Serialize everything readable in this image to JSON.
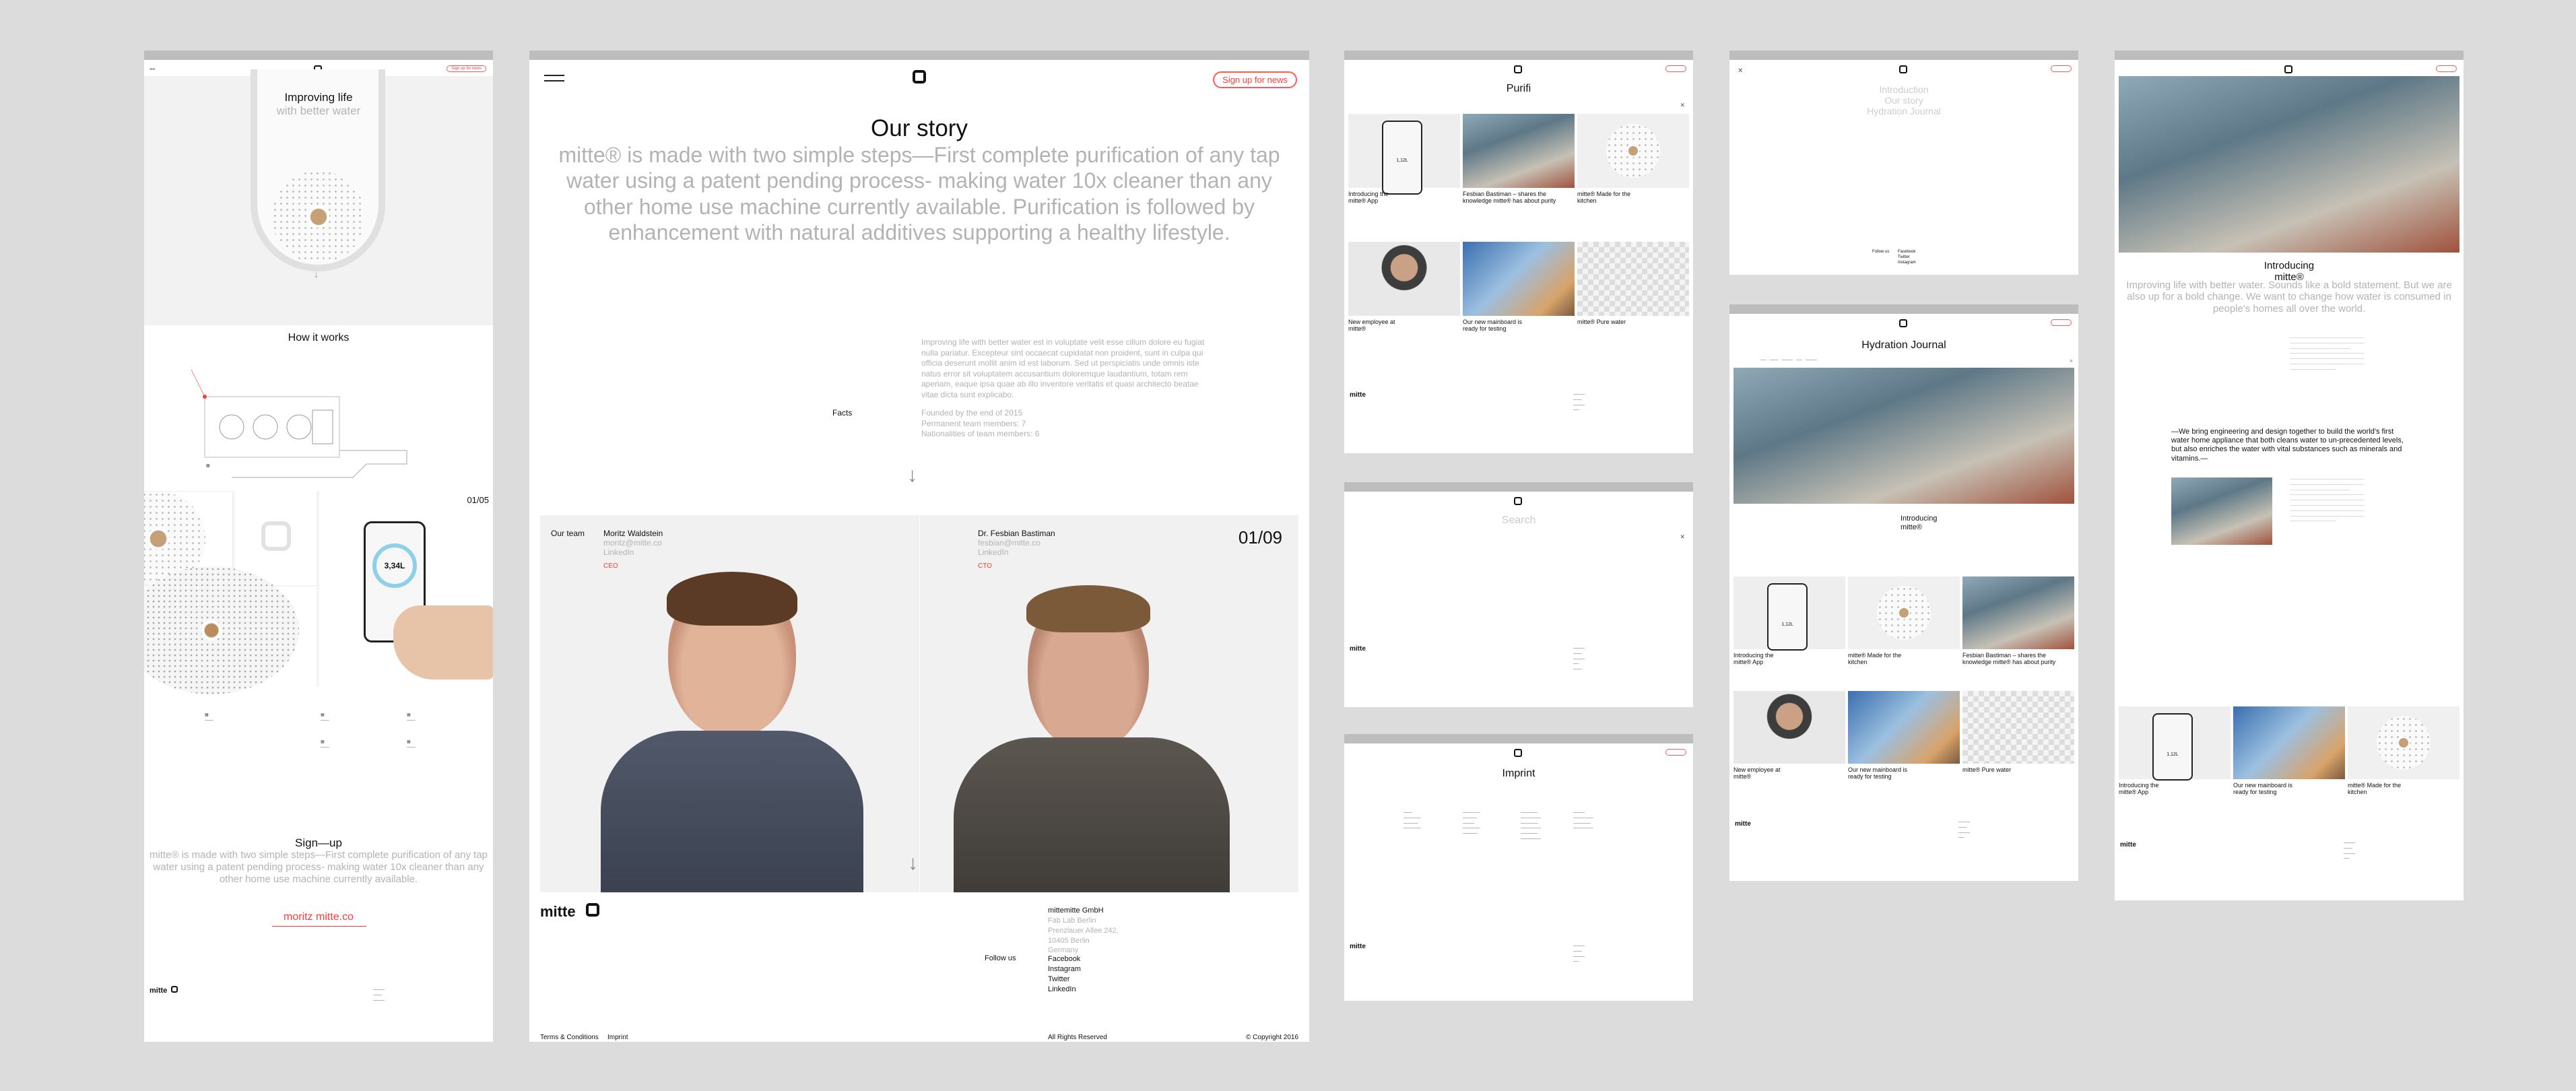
{
  "screen1": {
    "logo_text": "mitte",
    "cta": "Sign up for news",
    "hero_title": "Improving life",
    "hero_subtitle": "with better water",
    "how_title": "How it works",
    "counter": "01/05",
    "phone_value": "3,34L",
    "signup_title": "Sign—up",
    "signup_text": "mitte® is made with two simple steps—First complete purification of any tap water using a patent pending process- making water 10x cleaner than any other home use machine currently available.",
    "signup_email": "moritz mitte.co",
    "footer_brand": "mitte"
  },
  "screen2": {
    "cta": "Sign up for news",
    "title": "Our story",
    "lead": "mitte® is made with two simple steps—First complete purification of any tap water using a patent pending process- making water 10x cleaner than any other home use machine currently available. Purification is followed by enhancement with natural additives supporting a healthy lifestyle.",
    "body": "Improving life with better water est in voluptate velit esse cillum dolore eu fugiat nulla pariatur. Excepteur sint occaecat cupidatat non proident, sunt in culpa qui officia deserunt mollit anim id est laborum. Sed ut perspiciatis unde omnis iste natus error sit voluptatem accusantium doloremque laudantium, totam rem aperiam, eaque ipsa quae ab illo inventore veritatis et quasi architecto beatae vitae dicta sunt explicabo.",
    "facts_label": "Facts",
    "facts": [
      "Founded by the end of 2015",
      "Permanent team members: 7",
      "Nationalities of team members: 6"
    ],
    "team_label": "Our team",
    "member1": {
      "name": "Moritz Waldstein",
      "email": "moritz@mitte.co",
      "link": "LinkedIn",
      "role": "CEO"
    },
    "member2": {
      "name": "Dr. Fesbian Bastiman",
      "email": "fesbian@mitte.co",
      "link": "LinkedIn",
      "role": "CTO"
    },
    "counter": "01/09",
    "brand": "mitte",
    "company": [
      "mittemitte GmbH",
      "Fab Lab Berlin",
      "Prenzlauer Allee 242,",
      "10405 Berlin",
      "Germany"
    ],
    "follow_label": "Follow us",
    "social": [
      "Facebook",
      "Instagram",
      "Twitter",
      "LinkedIn"
    ],
    "footer_terms": "Terms & Conditions",
    "footer_imprint": "Imprint",
    "footer_rights": "All Rights Reserved",
    "footer_copy": "© Copyright 2016"
  },
  "screen3": {
    "title": "Purifi",
    "tiles": [
      {
        "title": "Introducing the mitte® App"
      },
      {
        "title": "Fesbian Bastiman – shares the knowledge mitte® has about purity"
      },
      {
        "title": "mitte® Made for the kitchen"
      },
      {
        "title": "New employee at mitte®"
      },
      {
        "title": "Our new mainboard is ready for testing"
      },
      {
        "title": "mitte® Pure water"
      }
    ],
    "phone_value": "1,12L",
    "brand": "mitte"
  },
  "screen4": {
    "search_placeholder": "Search",
    "brand": "mitte"
  },
  "screen5": {
    "title": "Imprint",
    "brand": "mitte"
  },
  "screen6": {
    "menu": [
      "Introduction",
      "Our story",
      "Hydration Journal"
    ],
    "follow_label": "Follow us",
    "social": [
      "Facebook",
      "Twitter",
      "Instagram"
    ]
  },
  "screen7": {
    "title": "Hydration Journal",
    "feature_title": "Introducing mitte®",
    "tiles": [
      {
        "title": "Introducing the mitte® App"
      },
      {
        "title": "mitte® Made for the kitchen"
      },
      {
        "title": "Fesbian Bastiman – shares the knowledge mitte® has about purity"
      },
      {
        "title": "New employee at mitte®"
      },
      {
        "title": "Our new mainboard is ready for testing"
      },
      {
        "title": "mitte® Pure water"
      }
    ],
    "phone_value": "1,12L",
    "brand": "mitte"
  },
  "screen8": {
    "title": "Introducing mitte®",
    "lead": "Improving life with better water. Sounds like a bold statement. But we are also up for a bold change. We want to change how water is consumed in people's homes all over the world.",
    "quote": "—We bring engineering and design together to build the world's first water home appliance that both cleans water to un-precedented levels, but also enriches the water with vital substances such as minerals and vitamins.—",
    "related": [
      {
        "title": "Introducing the mitte® App"
      },
      {
        "title": "Our new mainboard is ready for testing"
      },
      {
        "title": "mitte® Made for the kitchen"
      }
    ],
    "phone_value": "1,12L",
    "brand": "mitte"
  }
}
